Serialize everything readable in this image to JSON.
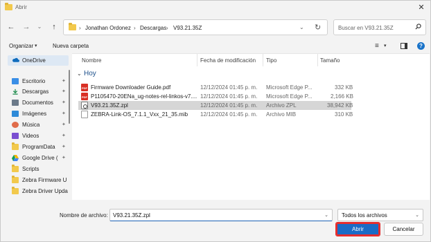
{
  "window": {
    "title": "Abrir",
    "close_glyph": "✕"
  },
  "nav": {
    "back_glyph": "←",
    "forward_glyph": "→",
    "recent_glyph": "⌄",
    "up_glyph": "↑",
    "breadcrumbs": [
      "Jonathan Ordonez",
      "Descargas",
      "V93.21.35Z"
    ],
    "sep_glyph": "›",
    "dropdown_glyph": "⌄",
    "refresh_glyph": "↻",
    "search_placeholder": "Buscar en V93.21.35Z"
  },
  "toolbar": {
    "organize_label": "Organizar",
    "organize_caret": "▾",
    "new_folder_label": "Nueva carpeta",
    "view_glyph": "≡",
    "view_caret": "▾",
    "help_glyph": "?"
  },
  "sidebar": {
    "items": [
      {
        "label": "OneDrive",
        "icon": "onedrive-icon",
        "pinned": false,
        "selected": true
      },
      {
        "label": "Escritorio",
        "icon": "desktop-icon",
        "pinned": true
      },
      {
        "label": "Descargas",
        "icon": "download-icon",
        "pinned": true
      },
      {
        "label": "Documentos",
        "icon": "documents-icon",
        "pinned": true
      },
      {
        "label": "Imágenes",
        "icon": "pictures-icon",
        "pinned": true
      },
      {
        "label": "Música",
        "icon": "music-icon",
        "pinned": true
      },
      {
        "label": "Videos",
        "icon": "videos-icon",
        "pinned": true
      },
      {
        "label": "ProgramData",
        "icon": "folder-icon",
        "pinned": true
      },
      {
        "label": "Google Drive (",
        "icon": "google-drive-icon",
        "pinned": true
      },
      {
        "label": "Scripts",
        "icon": "folder-icon",
        "pinned": false
      },
      {
        "label": "Zebra Firmware U",
        "icon": "folder-icon",
        "pinned": false
      },
      {
        "label": "Zebra Driver Upda",
        "icon": "folder-icon",
        "pinned": false
      }
    ],
    "pin_glyph": "📌"
  },
  "list": {
    "columns": [
      "Nombre",
      "Fecha de modificación",
      "Tipo",
      "Tamaño"
    ],
    "group_caret": "⌄",
    "group_title": "Hoy",
    "rows": [
      {
        "name": "Firmware Downloader Guide.pdf",
        "date": "12/12/2024 01:45 p. m.",
        "type": "Microsoft Edge P...",
        "size": "332 KB",
        "icon": "pdf"
      },
      {
        "name": "P1105470-20ENa_ug-notes-rel-linkos-v7....",
        "date": "12/12/2024 01:45 p. m.",
        "type": "Microsoft Edge P...",
        "size": "2,166 KB",
        "icon": "pdf"
      },
      {
        "name": "V93.21.35Z.zpl",
        "date": "12/12/2024 01:45 p. m.",
        "type": "Archivo ZPL",
        "size": "38,942 KB",
        "icon": "zpl",
        "selected": true
      },
      {
        "name": "ZEBRA-Link-OS_7.1.1_Vxx_21_35.mib",
        "date": "12/12/2024 01:45 p. m.",
        "type": "Archivo MIB",
        "size": "310 KB",
        "icon": "mib"
      }
    ]
  },
  "bottom": {
    "filename_label": "Nombre de archivo:",
    "filename_value": "V93.21.35Z.zpl",
    "filename_caret": "⌄",
    "filter_value": "Todos los archivos",
    "filter_caret": "⌄",
    "open_label": "Abrir",
    "cancel_label": "Cancelar"
  },
  "colors": {
    "accent": "#1a6bc6",
    "highlight_border": "#e52d2d",
    "folder": "#f2c94c",
    "pdf": "#d93025",
    "group_title": "#1b4f8a"
  }
}
